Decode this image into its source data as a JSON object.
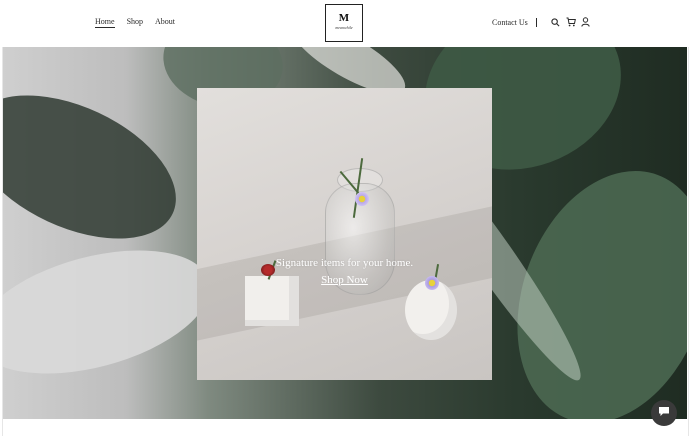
{
  "nav": {
    "home": "Home",
    "shop": "Shop",
    "about": "About",
    "contact": "Contact Us"
  },
  "logo": {
    "letter": "M",
    "script": "meanwhile"
  },
  "hero": {
    "tagline": "Signature items for your home.",
    "cta": "Shop Now"
  },
  "icons": [
    "search-icon",
    "cart-icon",
    "user-icon",
    "chat-icon"
  ],
  "colors": {
    "text": "#2b2b2b",
    "overlay_text": "#ffffff",
    "chat_bg": "#3a3a3a"
  }
}
